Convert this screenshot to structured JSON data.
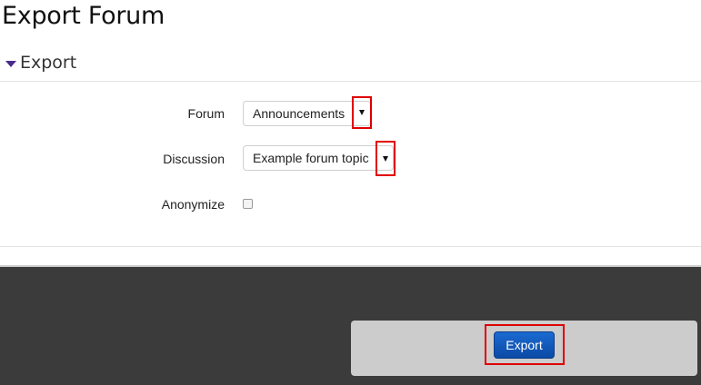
{
  "page": {
    "title": "Export Forum"
  },
  "section": {
    "title": "Export",
    "expanded": true
  },
  "form": {
    "forum": {
      "label": "Forum",
      "value": "Announcements"
    },
    "discussion": {
      "label": "Discussion",
      "value": "Example forum topic"
    },
    "anonymize": {
      "label": "Anonymize",
      "checked": false
    }
  },
  "actions": {
    "export_label": "Export"
  },
  "icons": {
    "section_toggle": "caret-down-icon",
    "select_arrow": "triangle-down-icon"
  },
  "colors": {
    "highlight": "#e00000",
    "accent": "#0b4aa6",
    "footer": "#3b3b3b",
    "panel": "#cccccc"
  }
}
